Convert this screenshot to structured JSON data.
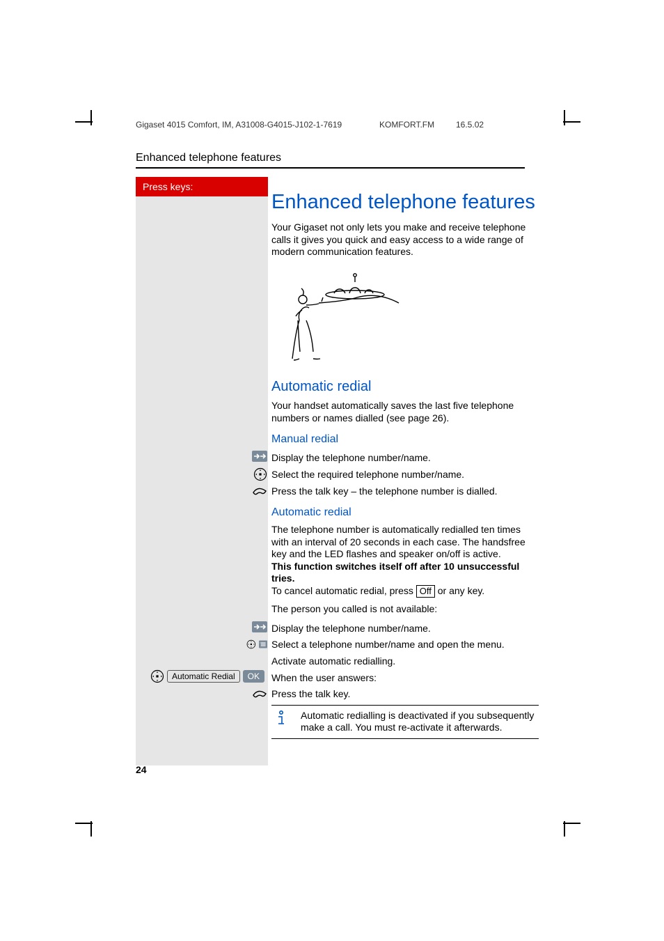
{
  "header": {
    "doc_id": "Gigaset 4015 Comfort, IM, A31008-G4015-J102-1-7619",
    "file": "KOMFORT.FM",
    "date": "16.5.02"
  },
  "section_header": "Enhanced telephone features",
  "sidebar": {
    "press_keys": "Press keys:",
    "auto_redial_label": "Automatic Redial",
    "ok_label": "OK"
  },
  "content": {
    "title": "Enhanced telephone features",
    "intro": "Your Gigaset not only lets you make and receive telephone calls it gives you quick and easy access to a wide range of modern communication features.",
    "h2_auto_redial": "Automatic redial",
    "auto_redial_intro": "Your handset automatically saves the last five telephone numbers or names dialled (see page 26).",
    "h3_manual": "Manual redial",
    "manual_steps": [
      "Display the telephone number/name.",
      "Select the required telephone number/name.",
      "Press the talk key – the telephone number is dialled."
    ],
    "h3_auto": "Automatic redial",
    "auto_para1": "The telephone number is automatically redialled ten times with an interval of 20 seconds in each case. The handsfree key and the LED flashes and speaker on/off is active.",
    "auto_bold": "This function switches itself off after 10 unsuccessful tries.",
    "auto_cancel_pre": "To cancel automatic redial, press ",
    "off_label": "Off",
    "auto_cancel_post": " or any key.",
    "auto_unavail": "The person you called is not available:",
    "auto_steps": [
      "Display the telephone number/name.",
      "Select a telephone number/name and open the menu.",
      "Activate automatic redialling.",
      "When the user answers:",
      "Press the talk key."
    ],
    "info_note": "Automatic redialling is deactivated if you subsequently make a call. You must re-activate it afterwards."
  },
  "page_number": "24"
}
